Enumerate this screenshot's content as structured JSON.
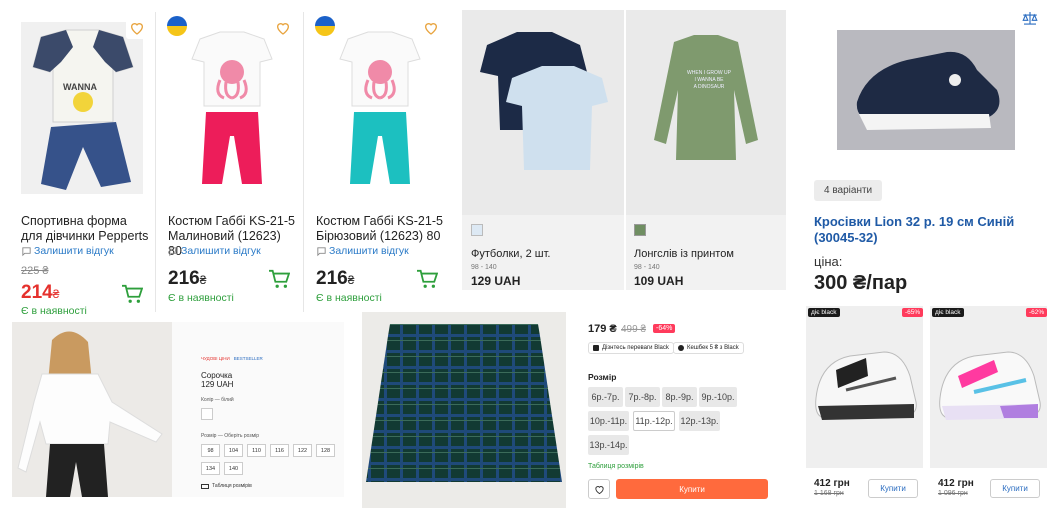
{
  "cards": [
    {
      "title": "Спортивна форма для дівчинки Pepperts",
      "review": "Залишити відгук",
      "old": "225 ₴",
      "price": "214",
      "currency": "₴",
      "avail": "Є в наявності"
    },
    {
      "title": "Костюм Габбі KS-21-5 Малиновий (12623) 80",
      "review": "Залишити відгук",
      "price": "216",
      "currency": "₴",
      "avail": "Є в наявності"
    },
    {
      "title": "Костюм Габбі KS-21-5 Бірюзовий (12623) 80",
      "review": "Залишити відгук",
      "price": "216",
      "currency": "₴",
      "avail": "Є в наявності"
    }
  ],
  "tees": {
    "name": "Футболки, 2 шт.",
    "sizes": "98 - 140",
    "price": "129 UAH"
  },
  "longsleeve": {
    "name": "Лонгслів із принтом",
    "sizes": "98 - 140",
    "price": "109 UAH",
    "print_line1": "WHEN I GROW UP",
    "print_line2": "I WANNA BE",
    "print_line3": "A DINOSAUR"
  },
  "sneaker": {
    "variants": "4 варіанти",
    "title": "Кросівки Lion 32 р. 19 см Синій (30045-32)",
    "price_label": "ціна:",
    "price": "300 ₴/пар"
  },
  "shirt": {
    "tag1": "ЧУДОВІ ЦІНИ",
    "tag2": "BESTSELLER",
    "name": "Сорочка",
    "price": "129 UAH",
    "color_label": "Колір — білий",
    "size_label": "Розмір — Оберіть розмір",
    "sizes": [
      "98",
      "104",
      "110",
      "116",
      "122",
      "128",
      "134",
      "140"
    ],
    "size_table": "Таблиця розмірів"
  },
  "skirt": {
    "price": "179 ₴",
    "old": "499 ₴",
    "disc": "-64%",
    "tag1": "Дізнтесь переваги Black",
    "tag2": "Кешбек 5 ₴ з Black",
    "size_title": "Розмір",
    "sizes": [
      "6р.-7р.",
      "7р.-8р.",
      "8р.-9р.",
      "9р.-10р.",
      "10р.-11р.",
      "11р.-12р.",
      "12р.-13р.",
      "13р.-14р."
    ],
    "size_table": "Таблиця розмірів",
    "buy": "Купити"
  },
  "shoes": [
    {
      "badge": "діє black",
      "disc": "-65%",
      "price": "412 грн",
      "old": "1 168 грн",
      "buy": "Купити"
    },
    {
      "badge": "діє black",
      "disc": "-62%",
      "price": "412 грн",
      "old": "1 096 грн",
      "buy": "Купити"
    }
  ],
  "colors": {
    "red": "#e5312d",
    "green": "#2e9f3c",
    "orange": "#ff6a3d"
  }
}
